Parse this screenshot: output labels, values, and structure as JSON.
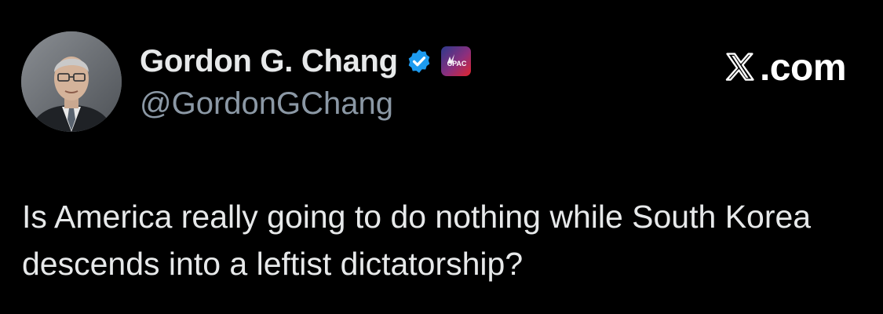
{
  "tweet": {
    "author": {
      "display_name": "Gordon G. Chang",
      "handle": "@GordonGChang",
      "avatar_icon": "avatar-photo",
      "verified_icon": "verified-badge-icon",
      "affiliation_icon": "cpac-badge-icon",
      "affiliation_label": "CPAC"
    },
    "brand": {
      "mark": "𝕏",
      "suffix": ".com"
    },
    "text": "Is America really going to do nothing while South Korea descends into a leftist dictatorship?"
  },
  "colors": {
    "background": "#000000",
    "primary_text": "#e7e9ea",
    "secondary_text": "#8b98a5",
    "verified_blue": "#1d9bf0",
    "cpac_red": "#e0252e",
    "cpac_blue": "#2c3a8c"
  }
}
